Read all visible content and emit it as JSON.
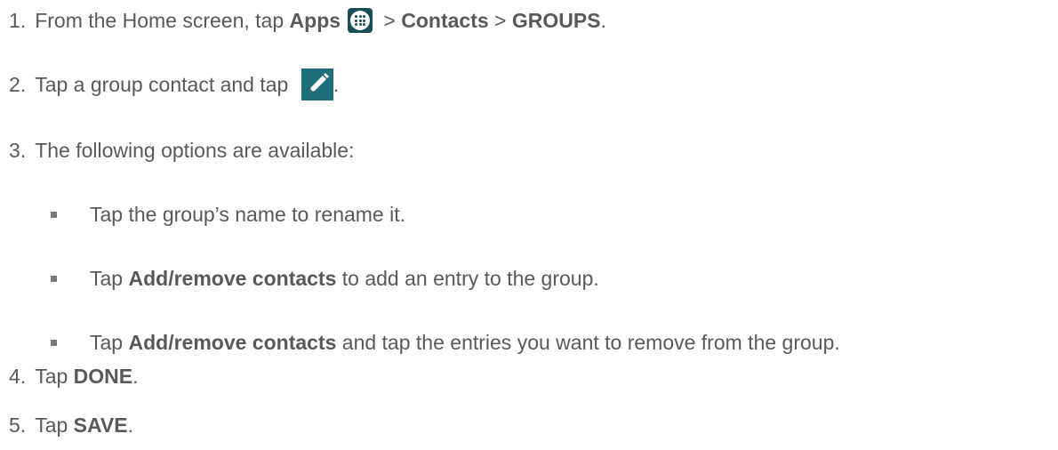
{
  "steps": [
    {
      "number": "1.",
      "parts": {
        "a": "From the Home screen, tap ",
        "b": "Apps",
        "c": " > ",
        "d": "Contacts",
        "e": " > ",
        "f": "GROUPS",
        "g": "."
      }
    },
    {
      "number": "2.",
      "parts": {
        "a": "Tap a group contact and tap ",
        "b": "."
      }
    },
    {
      "number": "3.",
      "parts": {
        "a": "The following options are available:"
      }
    },
    {
      "number": "4.",
      "parts": {
        "a": "Tap ",
        "b": "DONE",
        "c": "."
      }
    },
    {
      "number": "5.",
      "parts": {
        "a": "Tap ",
        "b": "SAVE",
        "c": "."
      }
    }
  ],
  "options": [
    {
      "a": "Tap the group’s name to rename it."
    },
    {
      "a": "Tap ",
      "b": "Add/remove contacts",
      "c": " to add an entry to the group."
    },
    {
      "a": "Tap ",
      "b": "Add/remove contacts",
      "c": " and tap the entries you want to remove from the group."
    }
  ],
  "icons": {
    "apps": "apps-icon",
    "edit": "edit-pencil-icon"
  },
  "colors": {
    "text": "#595959",
    "icon_dark_teal": "#1a4d5a",
    "icon_teal": "#1f6e7c"
  }
}
